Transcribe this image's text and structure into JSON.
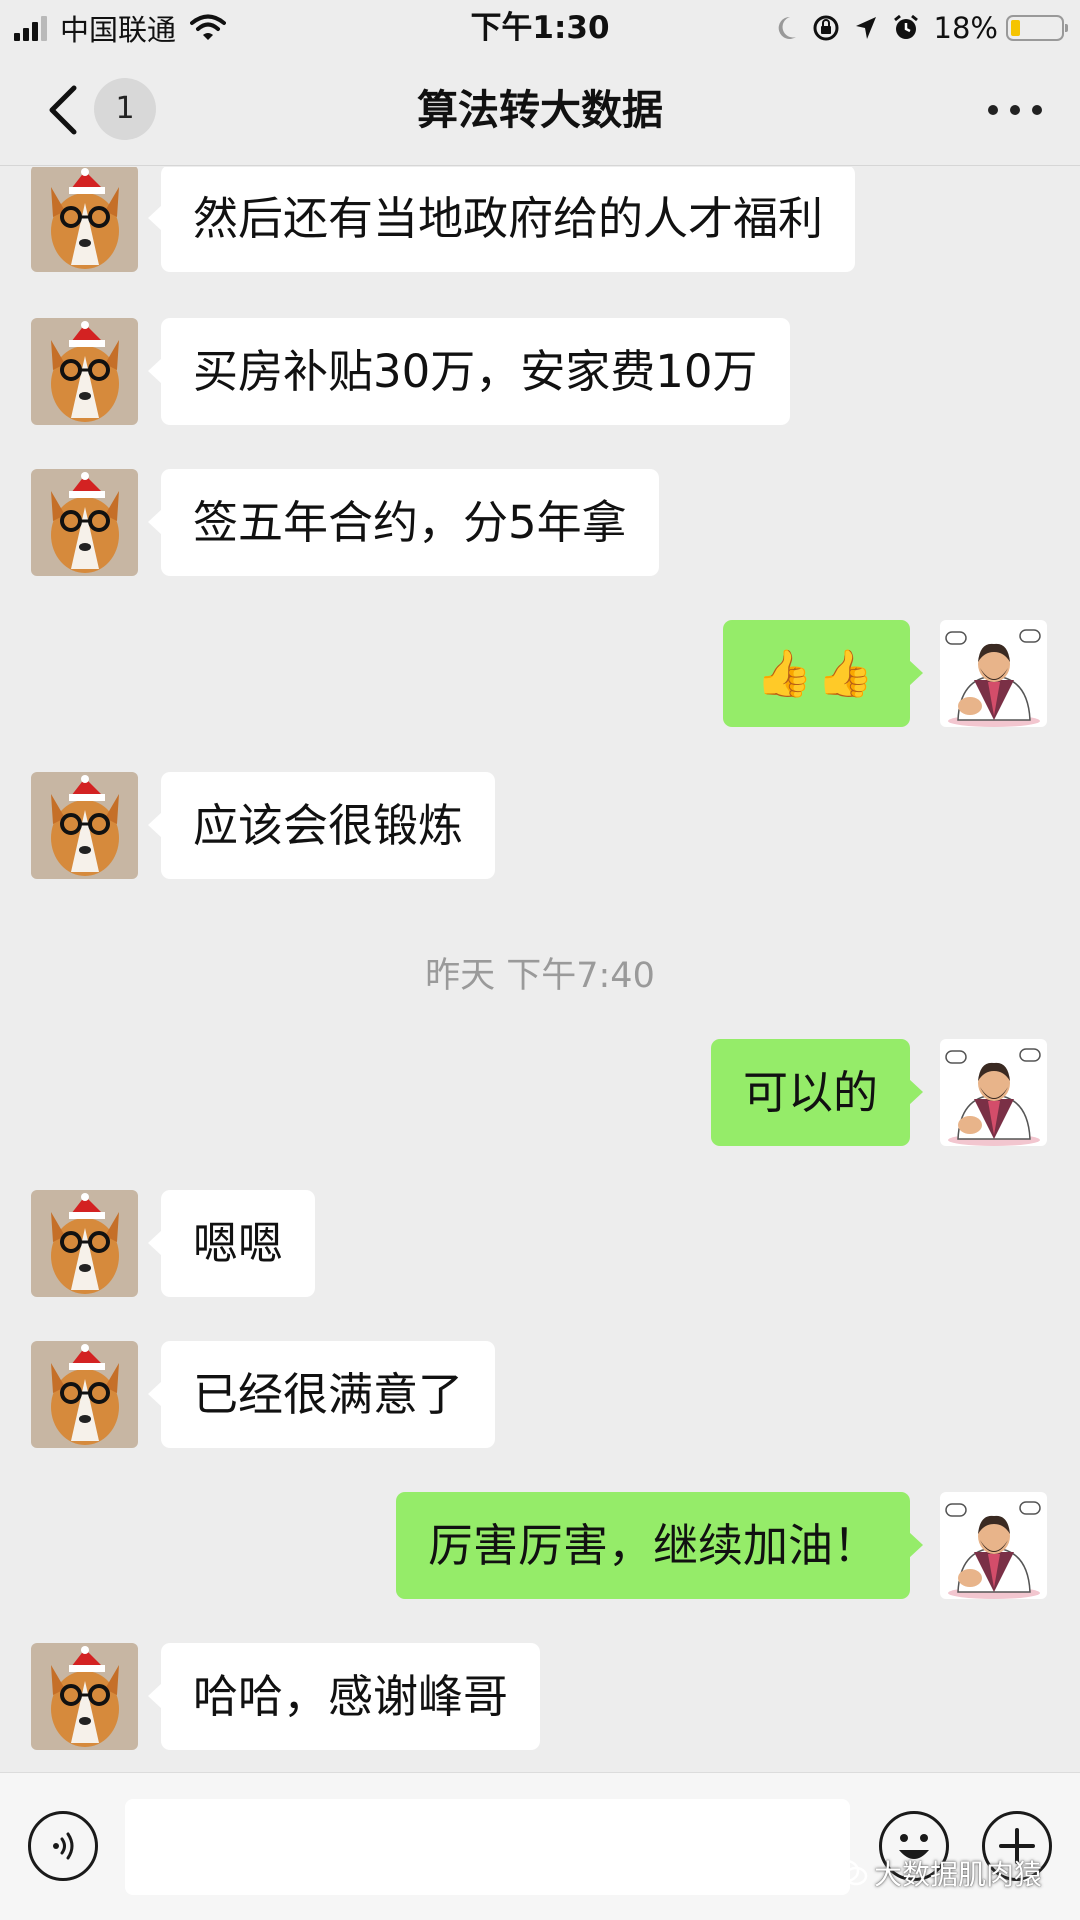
{
  "status_bar": {
    "carrier": "中国联通",
    "time": "下午1:30",
    "battery_percent": "18%",
    "battery_level": 0.18,
    "icons": [
      "signal-icon",
      "wifi-icon",
      "moon-icon",
      "orientation-lock-icon",
      "location-icon",
      "alarm-icon",
      "battery-icon"
    ]
  },
  "nav": {
    "unread_count": "1",
    "title": "算法转大数据",
    "icons": [
      "back-chevron-icon",
      "more-icon"
    ]
  },
  "messages": [
    {
      "side": "left",
      "text": "然后还有当地政府给的人才福利"
    },
    {
      "side": "left",
      "text": "买房补贴30万，安家费10万"
    },
    {
      "side": "left",
      "text": "签五年合约，分5年拿"
    },
    {
      "side": "right",
      "emoji": [
        "👍",
        "👍"
      ]
    },
    {
      "side": "left",
      "text": "应该会很锻炼"
    },
    {
      "timestamp": "昨天 下午7:40"
    },
    {
      "side": "right",
      "text": "可以的"
    },
    {
      "side": "left",
      "text": "嗯嗯"
    },
    {
      "side": "left",
      "text": "已经很满意了"
    },
    {
      "side": "right",
      "text": "厉害厉害，继续加油！"
    },
    {
      "side": "left",
      "text": "哈哈，感谢峰哥"
    }
  ],
  "input_bar": {
    "icons": [
      "voice-icon",
      "emoji-icon",
      "plus-icon"
    ],
    "watermark": "大数据肌肉猿"
  }
}
